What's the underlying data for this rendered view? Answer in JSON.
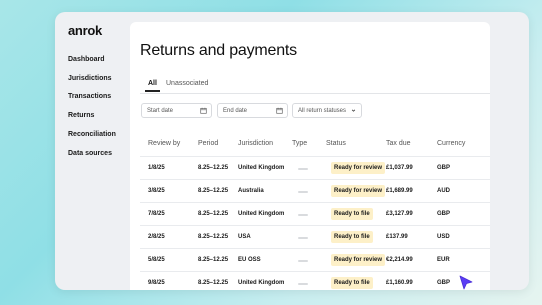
{
  "app": {
    "logo": "anrok"
  },
  "sidebar": {
    "items": [
      {
        "label": "Dashboard"
      },
      {
        "label": "Jurisdictions"
      },
      {
        "label": "Transactions"
      },
      {
        "label": "Returns"
      },
      {
        "label": "Reconciliation"
      },
      {
        "label": "Data sources"
      }
    ]
  },
  "page": {
    "title": "Returns and payments",
    "tabs": [
      {
        "label": "All",
        "active": true
      },
      {
        "label": "Unassociated",
        "active": false
      }
    ],
    "filters": {
      "start_date": "Start date",
      "end_date": "End date",
      "status": "All return statuses"
    }
  },
  "table": {
    "headers": [
      "Review by",
      "Period",
      "Jurisdiction",
      "Type",
      "Status",
      "Tax due",
      "Currency"
    ],
    "rows": [
      {
        "review_by": "1/8/25",
        "period": "8.25–12.25",
        "jurisdiction": "United Kingdom",
        "status": "Ready for review",
        "tax_due": "£1,037.99",
        "currency": "GBP"
      },
      {
        "review_by": "3/8/25",
        "period": "8.25–12.25",
        "jurisdiction": "Australia",
        "status": "Ready for review",
        "tax_due": "£1,689.99",
        "currency": "AUD"
      },
      {
        "review_by": "7/8/25",
        "period": "8.25–12.25",
        "jurisdiction": "United Kingdom",
        "status": "Ready to file",
        "tax_due": "£3,127.99",
        "currency": "GBP"
      },
      {
        "review_by": "2/8/25",
        "period": "8.25–12.25",
        "jurisdiction": "USA",
        "status": "Ready to file",
        "tax_due": "£137.99",
        "currency": "USD"
      },
      {
        "review_by": "5/8/25",
        "period": "8.25–12.25",
        "jurisdiction": "EU OSS",
        "status": "Ready for review",
        "tax_due": "€2,214.99",
        "currency": "EUR"
      },
      {
        "review_by": "9/8/25",
        "period": "8.25–12.25",
        "jurisdiction": "United Kingdom",
        "status": "Ready to file",
        "tax_due": "£1,160.99",
        "currency": "GBP"
      }
    ]
  },
  "colors": {
    "status_badge": "#fdf0c8",
    "cursor": "#5b3df5",
    "background_start": "#a8e6e8"
  },
  "icons": {
    "calendar": "calendar-icon",
    "chevron": "chevron-down-icon",
    "cursor": "pointer-cursor-icon"
  }
}
